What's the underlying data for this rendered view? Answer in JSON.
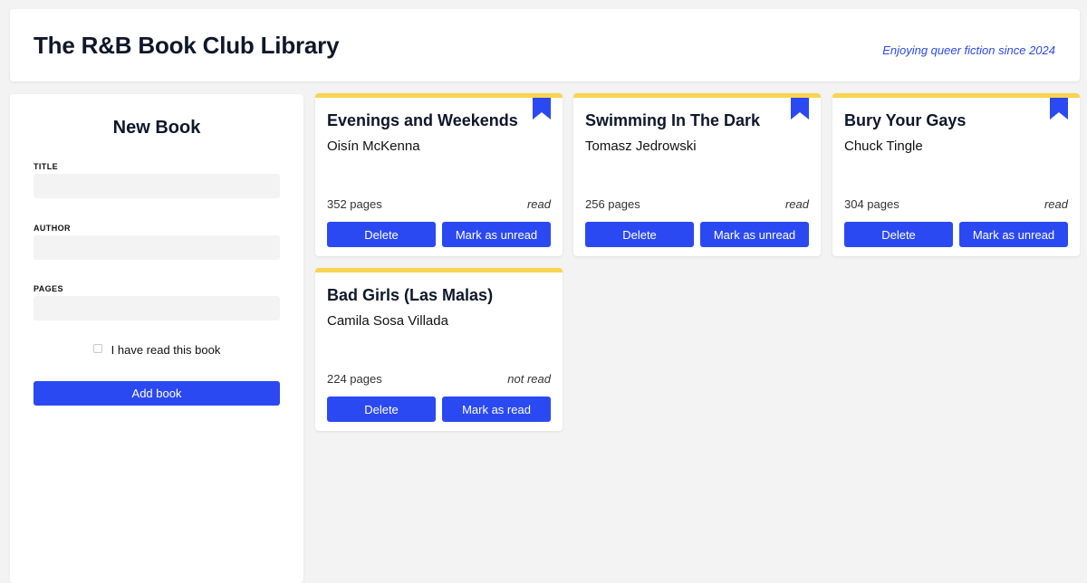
{
  "header": {
    "title": "The R&B Book Club Library",
    "tagline": "Enjoying queer fiction since 2024"
  },
  "form": {
    "heading": "New Book",
    "title_label": "TITLE",
    "title_value": "",
    "author_label": "AUTHOR",
    "author_value": "",
    "pages_label": "PAGES",
    "pages_value": "",
    "read_label": "I have read this book",
    "read_checked": false,
    "submit_label": "Add book"
  },
  "colors": {
    "accent": "#2b49f2",
    "card_top": "#f9d451",
    "background": "#f3f3f3"
  },
  "books": [
    {
      "title": "Evenings and Weekends",
      "author": "Oisín McKenna",
      "pages": "352 pages",
      "status": "read",
      "bookmarked": true,
      "delete_label": "Delete",
      "toggle_label": "Mark as unread"
    },
    {
      "title": "Swimming In The Dark",
      "author": "Tomasz Jedrowski",
      "pages": "256 pages",
      "status": "read",
      "bookmarked": true,
      "delete_label": "Delete",
      "toggle_label": "Mark as unread"
    },
    {
      "title": "Bury Your Gays",
      "author": "Chuck Tingle",
      "pages": "304 pages",
      "status": "read",
      "bookmarked": true,
      "delete_label": "Delete",
      "toggle_label": "Mark as unread"
    },
    {
      "title": "Bad Girls (Las Malas)",
      "author": "Camila Sosa Villada",
      "pages": "224 pages",
      "status": "not read",
      "bookmarked": false,
      "delete_label": "Delete",
      "toggle_label": "Mark as read"
    }
  ]
}
